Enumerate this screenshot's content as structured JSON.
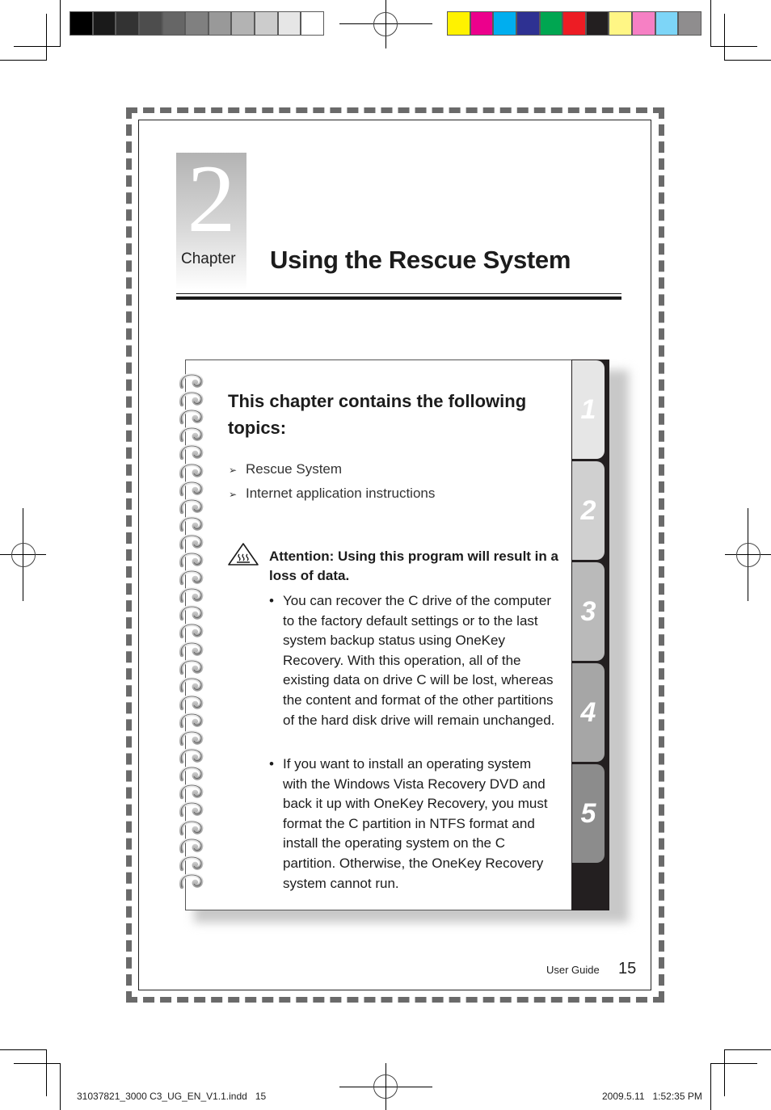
{
  "print_marks": {
    "gray_swatches": [
      "#000000",
      "#1a1a1a",
      "#333333",
      "#4d4d4d",
      "#666666",
      "#808080",
      "#999999",
      "#b3b3b3",
      "#cccccc",
      "#e6e6e6",
      "#ffffff"
    ],
    "color_swatches": [
      "#fff200",
      "#ec008c",
      "#00aeef",
      "#2e3192",
      "#00a651",
      "#ed1c24",
      "#231f20",
      "#fff685",
      "#f680c4",
      "#7dd5f7",
      "#8f8d8e"
    ],
    "slug_left": "31037821_3000 C3_UG_EN_V1.1.indd   15",
    "slug_right": "2009.5.11   1:52:35 PM"
  },
  "chapter": {
    "number": "2",
    "label": "Chapter",
    "title": "Using the Rescue System"
  },
  "notebook": {
    "heading": "This chapter contains the following topics:",
    "topics": [
      "Rescue System",
      "Internet application instructions"
    ],
    "attention_icon": "hot-surface-warning-icon",
    "attention": "Attention: Using this program will result in a loss of data.",
    "bullets": [
      "You can recover the C drive of the computer to the factory default settings or to the last system backup status using OneKey Recovery. With this operation, all of the existing data on drive C will be lost, whereas the content and format of the other partitions of the hard disk drive will remain unchanged.",
      "If you want to install an operating system with the Windows Vista Recovery DVD and back it up with OneKey Recovery, you must format the C partition in NTFS format and install the operating system on the C partition. Otherwise, the OneKey Recovery system cannot run."
    ],
    "tabs": [
      {
        "label": "1",
        "color": "#e6e6e6"
      },
      {
        "label": "2",
        "color": "#d0d0d0"
      },
      {
        "label": "3",
        "color": "#bababa"
      },
      {
        "label": "4",
        "color": "#a6a6a6"
      },
      {
        "label": "5",
        "color": "#8c8c8c"
      }
    ]
  },
  "footer": {
    "label": "User Guide",
    "page": "15"
  }
}
